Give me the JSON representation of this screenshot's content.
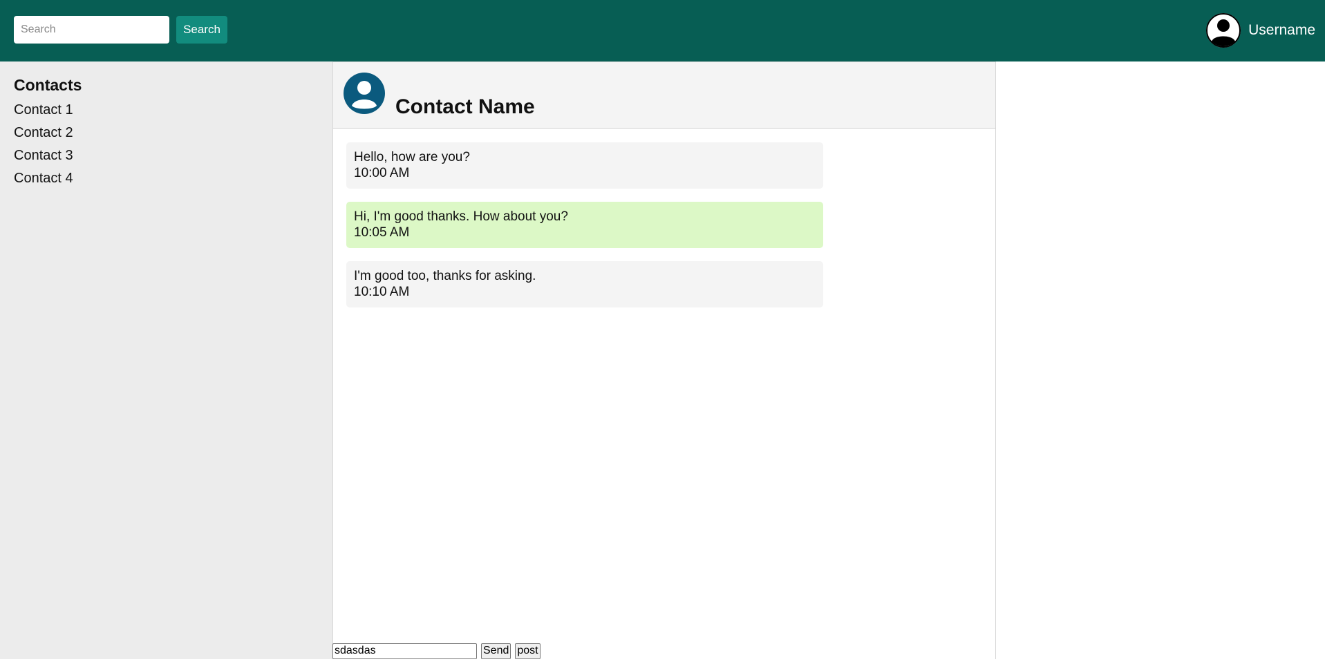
{
  "header": {
    "search": {
      "placeholder": "Search",
      "value": ""
    },
    "search_button_label": "Search",
    "username": "Username",
    "avatar_icon": "user-avatar-icon"
  },
  "sidebar": {
    "title": "Contacts",
    "contacts": [
      {
        "label": "Contact 1"
      },
      {
        "label": "Contact 2"
      },
      {
        "label": "Contact 3"
      },
      {
        "label": "Contact 4"
      }
    ]
  },
  "chat": {
    "contact_name": "Contact Name",
    "contact_avatar_icon": "contact-avatar-icon",
    "messages": [
      {
        "text": "Hello, how are you?",
        "time": "10:00 AM",
        "type": "received"
      },
      {
        "text": "Hi, I'm good thanks. How about you?",
        "time": "10:05 AM",
        "type": "sent"
      },
      {
        "text": "I'm good too, thanks for asking.",
        "time": "10:10 AM",
        "type": "received"
      }
    ]
  },
  "composer": {
    "input_value": "sdasdas",
    "send_label": "Send",
    "post_label": "post"
  },
  "colors": {
    "header_bg": "#075e54",
    "button_bg": "#128c7e",
    "sent_bubble": "#dcf8c6",
    "received_bubble": "#f4f4f4",
    "sidebar_bg": "#ececec",
    "contact_avatar": "#0b5a7e"
  }
}
